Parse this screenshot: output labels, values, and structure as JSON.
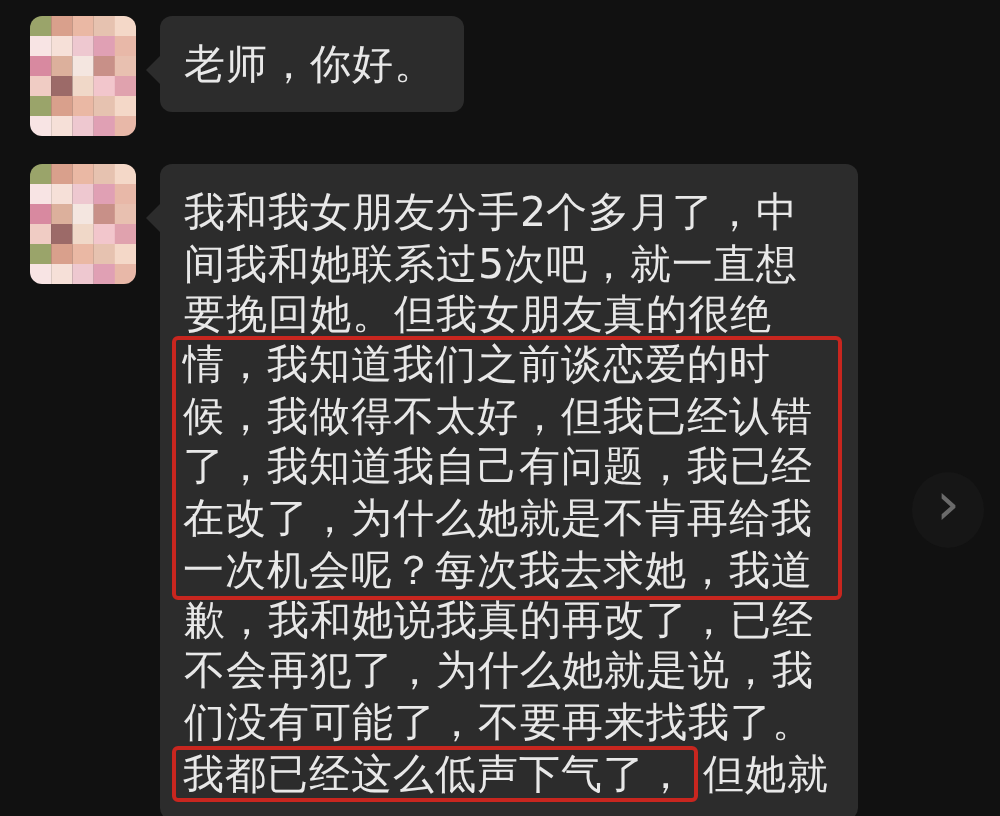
{
  "messages": [
    {
      "lines": [
        {
          "parts": [
            {
              "text": "老师，你好。",
              "highlighted": false
            }
          ]
        }
      ]
    },
    {
      "lines": [
        {
          "parts": [
            {
              "text": "我和我女朋友分手2个多月了，中",
              "highlighted": false
            }
          ]
        },
        {
          "parts": [
            {
              "text": "间我和她联系过5次吧，就一直想",
              "highlighted": false
            }
          ]
        },
        {
          "parts": [
            {
              "text": "要挽回她。但我女朋友真的很绝",
              "highlighted": false
            }
          ]
        },
        {
          "parts": [
            {
              "text": "情，我知道我们之前谈恋爱的时",
              "highlighted": true
            }
          ]
        },
        {
          "parts": [
            {
              "text": "候，我做得不太好，但我已经认错",
              "highlighted": true
            }
          ]
        },
        {
          "parts": [
            {
              "text": "了，我知道我自己有问题，我已经",
              "highlighted": true
            }
          ]
        },
        {
          "parts": [
            {
              "text": "在改了，为什么她就是不肯再给我",
              "highlighted": true
            }
          ]
        },
        {
          "parts": [
            {
              "text": "一次机会呢？每次我去求她，我道",
              "highlighted": true
            }
          ]
        },
        {
          "parts": [
            {
              "text": "歉，我和她说我真的再改了，已经",
              "highlighted": false
            }
          ]
        },
        {
          "parts": [
            {
              "text": "不会再犯了，为什么她就是说，我",
              "highlighted": false
            }
          ]
        },
        {
          "parts": [
            {
              "text": "们没有可能了，不要再来找我了。",
              "highlighted": false
            }
          ]
        },
        {
          "parts": [
            {
              "text": "我都已经这么低声下气了，",
              "highlighted": true
            },
            {
              "text": "但她就",
              "highlighted": false
            }
          ]
        }
      ]
    }
  ],
  "next_button": {
    "label": "›"
  }
}
